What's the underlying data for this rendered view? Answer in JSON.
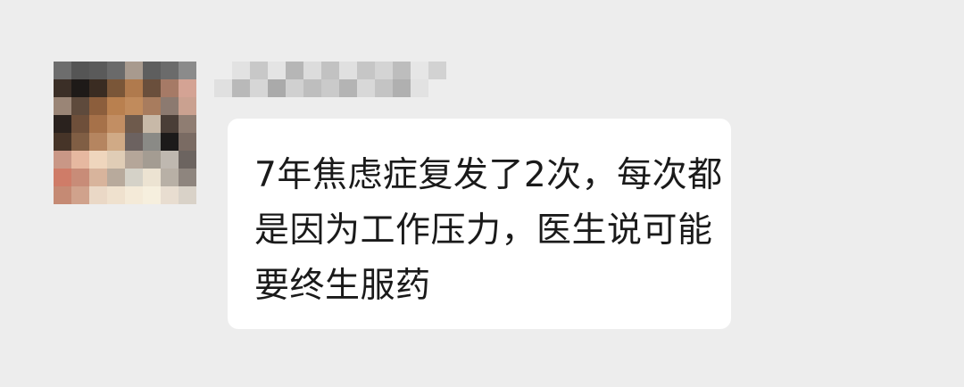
{
  "message": {
    "lines": [
      "7年焦虑症复发了2次，每次都",
      "是因为工作压力，医生说可能",
      "要终生服药"
    ]
  },
  "avatar_mosaic": [
    [
      "#6d6d6d",
      "#555555",
      "#5a5a5a",
      "#6a6a6a",
      "#a89a8e",
      "#5e5e5e",
      "#6b6b6b",
      "#8b8b8b"
    ],
    [
      "#3b2f27",
      "#1e1a18",
      "#3a2c22",
      "#7a5638",
      "#b07a4d",
      "#6a4f3c",
      "#a67a66",
      "#d4a394"
    ],
    [
      "#9a8576",
      "#5e4a3c",
      "#8c5e3c",
      "#b9804f",
      "#c18b5c",
      "#a87c5e",
      "#8c7a70",
      "#caa190"
    ],
    [
      "#2a221e",
      "#6e4f3a",
      "#a67149",
      "#c28e63",
      "#6e5a4c",
      "#c8b9a8",
      "#4a3e37",
      "#8f7d72"
    ],
    [
      "#463428",
      "#805e44",
      "#b58560",
      "#d0aa86",
      "#6c6260",
      "#8a8a86",
      "#1c1a1a",
      "#7a6b63"
    ],
    [
      "#c99786",
      "#e6b8a0",
      "#efd6bd",
      "#e0cdb6",
      "#b5a699",
      "#a49c92",
      "#bfb8b0",
      "#6c6460"
    ],
    [
      "#cf7c68",
      "#c88c78",
      "#d8b49c",
      "#b8aa9c",
      "#d5d2c8",
      "#ece3d2",
      "#b8b0a6",
      "#8e857e"
    ],
    [
      "#c58a74",
      "#d0a28c",
      "#ead8c6",
      "#efe1ce",
      "#f4ead8",
      "#f6efde",
      "#e8ddd0",
      "#d9d2c8"
    ]
  ],
  "username_mosaic": [
    [
      "#ededed",
      "#e2e2e2",
      "#c8c8c8",
      "#e4e4e4",
      "#b6b6b6",
      "#dcdcdc",
      "#c2c2c2",
      "#e0e0e0",
      "#c6c6c6",
      "#d4d4d4",
      "#bdbdbd",
      "#e6e6e6",
      "#d2d2d2"
    ],
    [
      "#e0e0e0",
      "#b9b9b9",
      "#d6d6d6",
      "#aaaaaa",
      "#d0d0d0",
      "#bebebe",
      "#cacaca",
      "#b4b4b4",
      "#d8d8d8",
      "#c4c4c4",
      "#b0b0b0",
      "#e2e2e2",
      "#ededed"
    ]
  ]
}
